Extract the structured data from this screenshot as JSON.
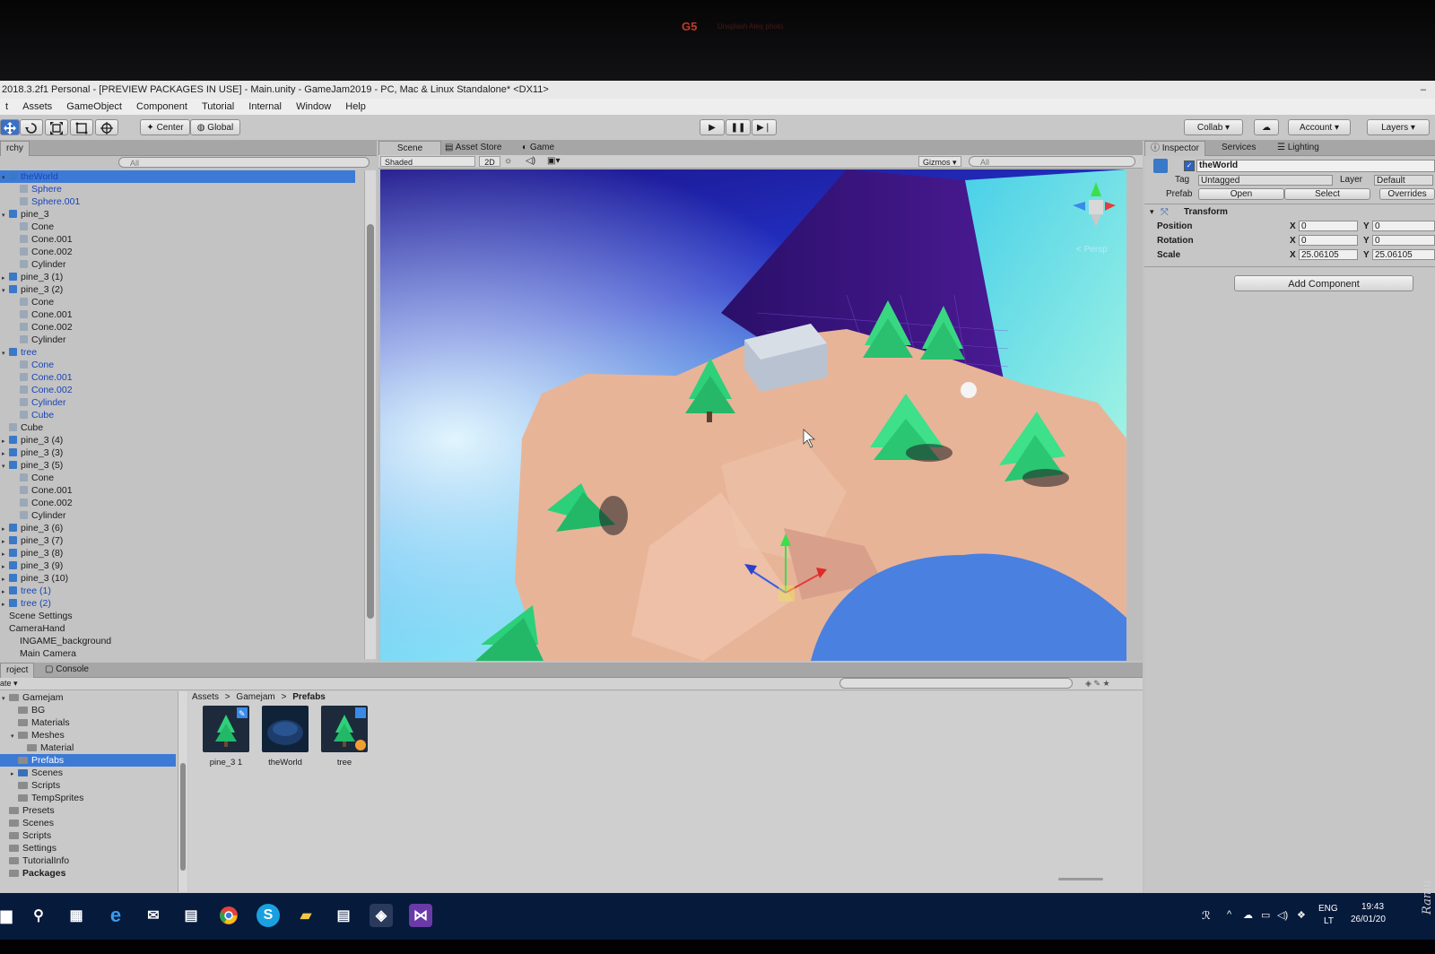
{
  "monitor": {
    "logo": "G5",
    "logo_sub": "Unsplash Ateş photo"
  },
  "window": {
    "title": "2018.3.2f1 Personal - [PREVIEW PACKAGES IN USE] - Main.unity - GameJam2019 - PC, Mac & Linux Standalone* <DX11>",
    "minimize": "–"
  },
  "menu": {
    "items": [
      "t",
      "Assets",
      "GameObject",
      "Component",
      "Tutorial",
      "Internal",
      "Window",
      "Help"
    ]
  },
  "toolbar": {
    "tools": [
      "move-tool",
      "rotate-tool",
      "scale-tool",
      "rect-tool",
      "transform-tool"
    ],
    "pivot_center": "Center",
    "pivot_global": "Global",
    "play_icon": "▶",
    "pause_icon": "❚❚",
    "step_icon": "▶❘",
    "collab": "Collab ▾",
    "cloud_icon": "☁",
    "account": "Account ▾",
    "layers": "Layers ▾"
  },
  "hierarchy": {
    "tab": "rchy",
    "search_placeholder": "All",
    "rows": [
      {
        "label": "theWorld",
        "indent": 0,
        "icon": "prefab",
        "selected": true,
        "blue": true,
        "arrow": "▾"
      },
      {
        "label": "Sphere",
        "indent": 1,
        "icon": "plain",
        "blue": true
      },
      {
        "label": "Sphere.001",
        "indent": 1,
        "icon": "plain",
        "blue": true
      },
      {
        "label": "pine_3",
        "indent": 0,
        "icon": "prefab",
        "arrow": "▾"
      },
      {
        "label": "Cone",
        "indent": 1,
        "icon": "plain"
      },
      {
        "label": "Cone.001",
        "indent": 1,
        "icon": "plain"
      },
      {
        "label": "Cone.002",
        "indent": 1,
        "icon": "plain"
      },
      {
        "label": "Cylinder",
        "indent": 1,
        "icon": "plain"
      },
      {
        "label": "pine_3 (1)",
        "indent": 0,
        "icon": "prefab",
        "arrow": "▸"
      },
      {
        "label": "pine_3 (2)",
        "indent": 0,
        "icon": "prefab",
        "arrow": "▾"
      },
      {
        "label": "Cone",
        "indent": 1,
        "icon": "plain"
      },
      {
        "label": "Cone.001",
        "indent": 1,
        "icon": "plain"
      },
      {
        "label": "Cone.002",
        "indent": 1,
        "icon": "plain"
      },
      {
        "label": "Cylinder",
        "indent": 1,
        "icon": "plain"
      },
      {
        "label": "tree",
        "indent": 0,
        "icon": "prefab",
        "blue": true,
        "arrow": "▾"
      },
      {
        "label": "Cone",
        "indent": 1,
        "icon": "plain",
        "blue": true
      },
      {
        "label": "Cone.001",
        "indent": 1,
        "icon": "plain",
        "blue": true
      },
      {
        "label": "Cone.002",
        "indent": 1,
        "icon": "plain",
        "blue": true
      },
      {
        "label": "Cylinder",
        "indent": 1,
        "icon": "plain",
        "blue": true
      },
      {
        "label": "Cube",
        "indent": 1,
        "icon": "plain",
        "blue": true
      },
      {
        "label": "Cube",
        "indent": 0,
        "icon": "plain"
      },
      {
        "label": "pine_3 (4)",
        "indent": 0,
        "icon": "prefab",
        "arrow": "▸"
      },
      {
        "label": "pine_3 (3)",
        "indent": 0,
        "icon": "prefab",
        "arrow": "▸"
      },
      {
        "label": "pine_3 (5)",
        "indent": 0,
        "icon": "prefab",
        "arrow": "▾"
      },
      {
        "label": "Cone",
        "indent": 1,
        "icon": "plain"
      },
      {
        "label": "Cone.001",
        "indent": 1,
        "icon": "plain"
      },
      {
        "label": "Cone.002",
        "indent": 1,
        "icon": "plain"
      },
      {
        "label": "Cylinder",
        "indent": 1,
        "icon": "plain"
      },
      {
        "label": "pine_3 (6)",
        "indent": 0,
        "icon": "prefab",
        "arrow": "▸"
      },
      {
        "label": "pine_3 (7)",
        "indent": 0,
        "icon": "prefab",
        "arrow": "▸"
      },
      {
        "label": "pine_3 (8)",
        "indent": 0,
        "icon": "prefab",
        "arrow": "▸"
      },
      {
        "label": "pine_3 (9)",
        "indent": 0,
        "icon": "prefab",
        "arrow": "▸"
      },
      {
        "label": "pine_3 (10)",
        "indent": 0,
        "icon": "prefab",
        "arrow": "▸"
      },
      {
        "label": "tree (1)",
        "indent": 0,
        "icon": "prefab",
        "blue": true,
        "arrow": "▸"
      },
      {
        "label": "tree (2)",
        "indent": 0,
        "icon": "prefab",
        "blue": true,
        "arrow": "▸"
      },
      {
        "label": "Scene Settings",
        "indent": 0,
        "icon": "none"
      },
      {
        "label": "CameraHand",
        "indent": 0,
        "icon": "none"
      },
      {
        "label": "INGAME_background",
        "indent": 1,
        "icon": "none"
      },
      {
        "label": "Main Camera",
        "indent": 1,
        "icon": "none"
      }
    ]
  },
  "scene": {
    "tabs": [
      "Scene",
      "Asset Store",
      "Game"
    ],
    "asset_store_icon": "🛍",
    "game_icon": "☾",
    "shading": "Shaded",
    "mode_2d": "2D",
    "gizmos": "Gizmos ▾",
    "search_placeholder": "All",
    "persp_label": "< Persp",
    "sky_top": "#2a1a9a",
    "sky_bottom": "#3ad6f0",
    "ground_color": "#e9b79a"
  },
  "inspector": {
    "tabs": [
      "Inspector",
      "Services",
      "Lighting"
    ],
    "object_name": "theWorld",
    "tag_label": "Tag",
    "tag_value": "Untagged",
    "layer_label": "Layer",
    "layer_value": "Default",
    "prefab_label": "Prefab",
    "prefab_open": "Open",
    "prefab_select": "Select",
    "prefab_overrides": "Overrides",
    "transform_title": "Transform",
    "position": {
      "label": "Position",
      "x": "0",
      "y": "0"
    },
    "rotation": {
      "label": "Rotation",
      "x": "0",
      "y": "0"
    },
    "scale": {
      "label": "Scale",
      "x": "25.06105",
      "y": "25.06105"
    },
    "x_axis": "X",
    "y_axis": "Y",
    "add_component": "Add Component"
  },
  "project": {
    "tabs": [
      "roject",
      "Console"
    ],
    "create_label": "ate ▾",
    "tree": [
      {
        "label": "Gamejam",
        "indent": 0,
        "arrow": "▾"
      },
      {
        "label": "BG",
        "indent": 1
      },
      {
        "label": "Materials",
        "indent": 1
      },
      {
        "label": "Meshes",
        "indent": 1,
        "arrow": "▾"
      },
      {
        "label": "Material",
        "indent": 2
      },
      {
        "label": "Prefabs",
        "indent": 1,
        "selected": true
      },
      {
        "label": "Scenes",
        "indent": 1,
        "arrow": "▸",
        "blue": true
      },
      {
        "label": "Scripts",
        "indent": 1
      },
      {
        "label": "TempSprites",
        "indent": 1
      },
      {
        "label": "Presets",
        "indent": 0
      },
      {
        "label": "Scenes",
        "indent": 0
      },
      {
        "label": "Scripts",
        "indent": 0
      },
      {
        "label": "Settings",
        "indent": 0
      },
      {
        "label": "TutorialInfo",
        "indent": 0
      },
      {
        "label": "Packages",
        "indent": 0,
        "bold": true
      }
    ],
    "breadcrumb": [
      "Assets",
      "Gamejam",
      "Prefabs"
    ],
    "breadcrumb_sep": ">",
    "assets": [
      {
        "name": "pine_3 1",
        "kind": "tree"
      },
      {
        "name": "theWorld",
        "kind": "world"
      },
      {
        "name": "tree",
        "kind": "tree"
      }
    ]
  },
  "taskbar": {
    "apps": [
      "windows-start",
      "search",
      "task-view",
      "edge",
      "mail",
      "store",
      "chrome",
      "skype",
      "file-explorer",
      "notepad",
      "unity",
      "visual-studio"
    ],
    "lang_top": "ENG",
    "lang_bottom": "LT",
    "time": "19:43",
    "date": "26/01/20"
  },
  "watermark": "Ramu"
}
